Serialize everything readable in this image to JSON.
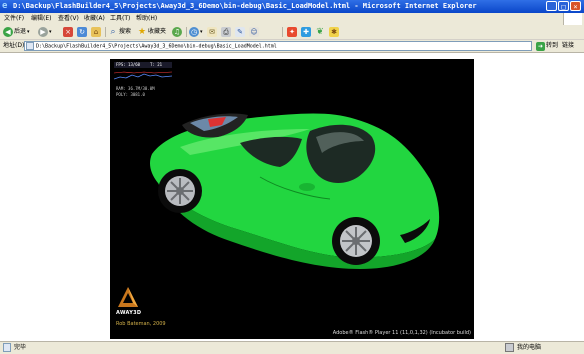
{
  "window": {
    "title": "D:\\Backup\\FlashBuilder4_5\\Projects\\Away3d_3_6Demo\\bin-debug\\Basic_LoadModel.html - Microsoft Internet Explorer"
  },
  "menu": [
    "文件(F)",
    "编辑(E)",
    "查看(V)",
    "收藏(A)",
    "工具(T)",
    "帮助(H)"
  ],
  "toolbar": {
    "back_label": "后退",
    "search_label": "搜索",
    "favorites_label": "收藏夹"
  },
  "address": {
    "label": "地址(D)",
    "url": "D:\\Backup\\FlashBuilder4_5\\Projects\\Away3d_3_6Demo\\bin-debug\\Basic_LoadModel.html",
    "go_label": "转到",
    "links_label": "链接"
  },
  "flash": {
    "stats": {
      "fps": "FPS: 13/60",
      "tris": "T: 21",
      "ram": "RAM: 36.7M/38.0M",
      "poly": "POLY: 3081.0"
    },
    "logo_text": "AWAY3D",
    "author_text": "Rob Bateman, 2009",
    "player_caption": "Adobe® Flash® Player 11 (11,0,1,32) (Incubator build)"
  },
  "status": {
    "left": "完毕",
    "right": "我的电脑"
  },
  "colors": {
    "title_bar": "#0a46c9",
    "car_body": "#22d640",
    "flash_bg": "#000000"
  }
}
